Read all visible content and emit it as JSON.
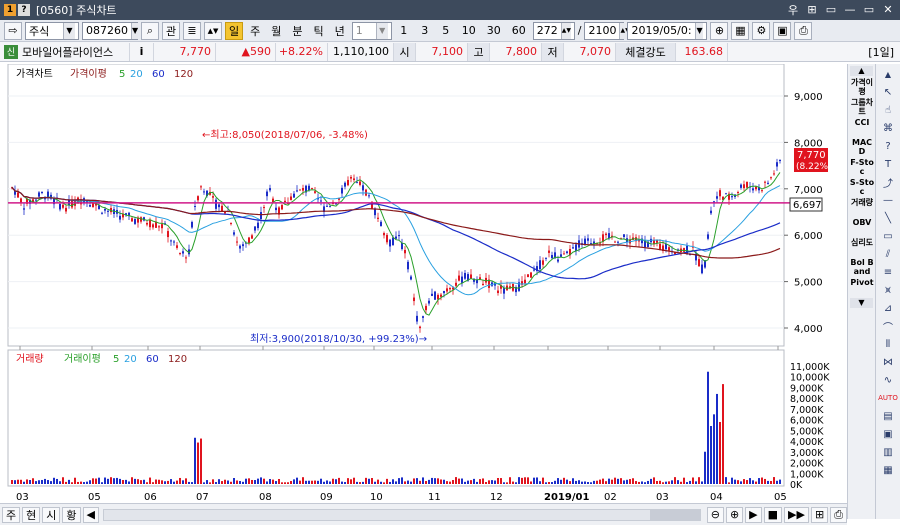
{
  "window": {
    "title": "[0560] 주식차트",
    "icon1": "1",
    "icon2": "?",
    "title_buttons": [
      "우",
      "⊞",
      "▭",
      "—",
      "▭",
      "✕"
    ]
  },
  "toolbar": {
    "market_select": "주식",
    "code_input": "087260",
    "related_button": "관",
    "periods": [
      "일",
      "주",
      "월",
      "분",
      "틱",
      "년"
    ],
    "interval_select": "1",
    "minute_buttons": [
      "1",
      "3",
      "5",
      "10",
      "30",
      "60"
    ],
    "count_value": "272",
    "separator": "/",
    "total_value": "2100",
    "date_value": "2019/05/0:"
  },
  "infobar": {
    "sin_label": "신",
    "stock_name": "모바일어플라이언스",
    "info_icon": "i",
    "price": "7,770",
    "change": "▲590",
    "change_pct": "+8.22%",
    "volume": "1,110,100",
    "open_label": "시",
    "open": "7,100",
    "high_label": "고",
    "high": "7,800",
    "low_label": "저",
    "low": "7,070",
    "strength_label": "체결강도",
    "strength": "163.68",
    "period_label": "[1일]"
  },
  "legend_price": {
    "name": "가격차트",
    "ma_label": "가격이평",
    "ma": [
      "5",
      "20",
      "60",
      "120"
    ]
  },
  "legend_volume": {
    "name": "거래량",
    "ma_label": "거래이평",
    "ma": [
      "5",
      "20",
      "60",
      "120"
    ]
  },
  "annotations": {
    "high": "←최고:8,050(2018/07/06, -3.48%)",
    "low": "최저:3,900(2018/10/30, +99.23%)→",
    "current_price": "7,770",
    "current_pct": "(8.22%)",
    "hline_value": "6,697"
  },
  "price_axis": [
    "9,000",
    "8,000",
    "7,000",
    "6,000",
    "5,000",
    "4,000"
  ],
  "volume_axis": [
    "11,000K",
    "10,000K",
    "9,000K",
    "8,000K",
    "7,000K",
    "6,000K",
    "5,000K",
    "4,000K",
    "3,000K",
    "2,000K",
    "1,000K",
    "0K"
  ],
  "x_axis": [
    "03",
    "05",
    "06",
    "07",
    "08",
    "09",
    "10",
    "11",
    "12",
    "2019/01",
    "02",
    "03",
    "04",
    "05"
  ],
  "right_panel": [
    "가격이평",
    "그룹차트",
    "CCI",
    "MACD",
    "F-Stoc",
    "S-Stoc",
    "거래량",
    "OBV",
    "심리도",
    "Bol Band",
    "Pivot"
  ],
  "bottom": {
    "tabs": [
      "주",
      "현",
      "시",
      "황"
    ],
    "scroll_left": "◀"
  },
  "colors": {
    "up": "#e0141e",
    "down": "#1a2cc8",
    "ma5": "#2aa02a",
    "ma20": "#29a0e0",
    "ma60": "#1a2cc8",
    "ma120": "#8b1a1a",
    "hline": "#d01a8a"
  }
}
